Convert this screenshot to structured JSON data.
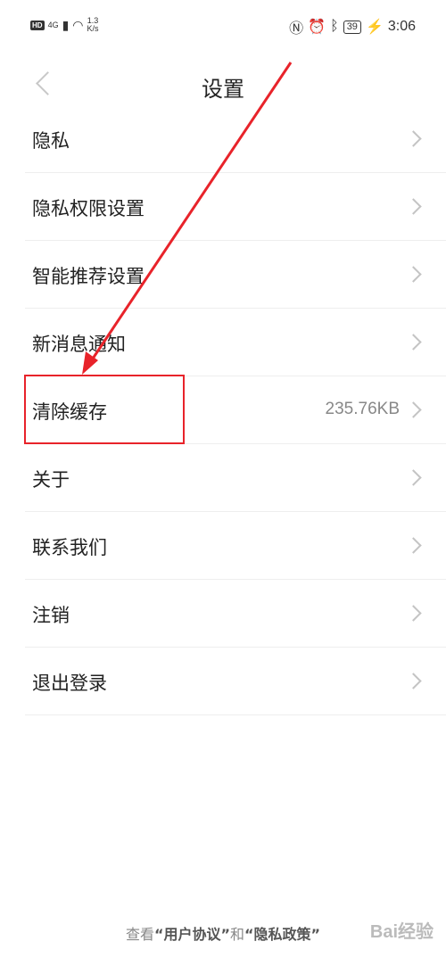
{
  "status_bar": {
    "hd": "HD",
    "network": "4G",
    "speed_value": "1.3",
    "speed_unit": "K/s",
    "battery": "39",
    "time": "3:06"
  },
  "header": {
    "title": "设置"
  },
  "settings_items": [
    {
      "label": "隐私",
      "value": ""
    },
    {
      "label": "隐私权限设置",
      "value": ""
    },
    {
      "label": "智能推荐设置",
      "value": ""
    },
    {
      "label": "新消息通知",
      "value": ""
    },
    {
      "label": "清除缓存",
      "value": "235.76KB"
    },
    {
      "label": "关于",
      "value": ""
    },
    {
      "label": "联系我们",
      "value": ""
    },
    {
      "label": "注销",
      "value": ""
    },
    {
      "label": "退出登录",
      "value": ""
    }
  ],
  "footer": {
    "prefix": "查看",
    "user_agreement": "“用户协议”",
    "and": "和",
    "privacy_policy": "“隐私政策”"
  },
  "watermark": "Bai经验",
  "colors": {
    "annotation": "#e8232a",
    "chevron": "#c4c4c4"
  }
}
